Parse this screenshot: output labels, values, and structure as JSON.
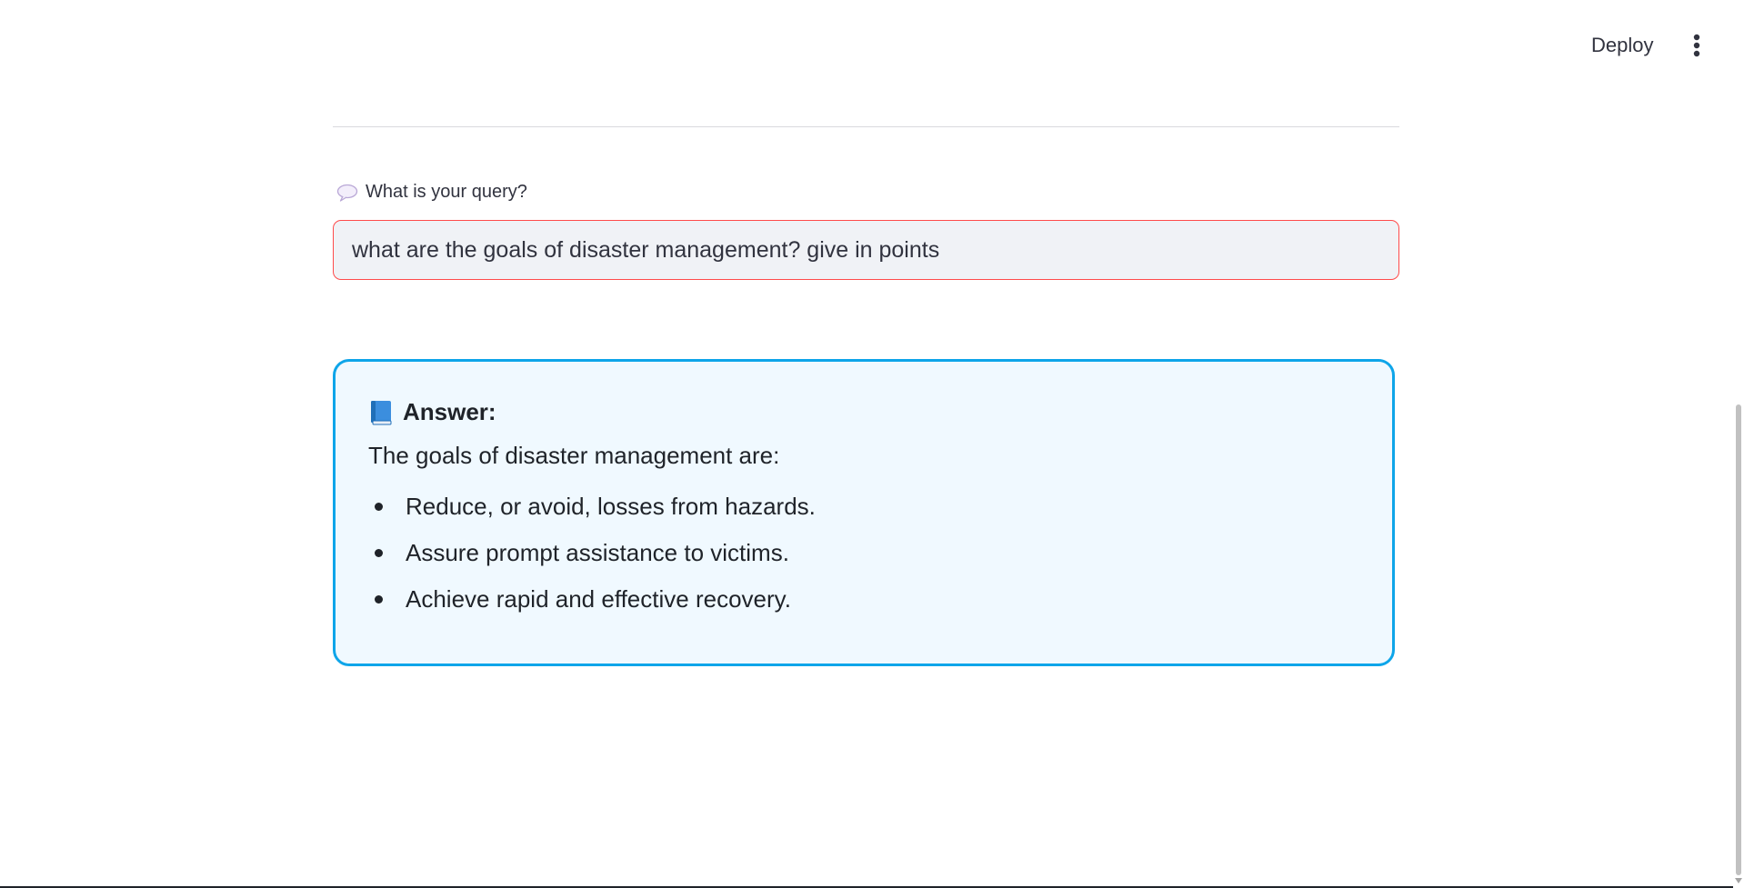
{
  "header": {
    "deploy_label": "Deploy",
    "menu_icon": "more-vertical-icon"
  },
  "query": {
    "label_icon": "speech-bubble-icon",
    "label": "What is your query?",
    "value": "what are the goals of disaster management? give in points"
  },
  "answer": {
    "icon": "blue-book-icon",
    "heading": "Answer:",
    "intro": "The goals of disaster management are:",
    "items": [
      "Reduce, or avoid, losses from hazards.",
      "Assure prompt assistance to victims.",
      "Achieve rapid and effective recovery."
    ]
  },
  "colors": {
    "accent_border": "#0ea5e9",
    "answer_bg": "#f0f9ff",
    "input_border": "#ff4b4b",
    "input_bg": "#f0f2f6",
    "text": "#31333f"
  }
}
